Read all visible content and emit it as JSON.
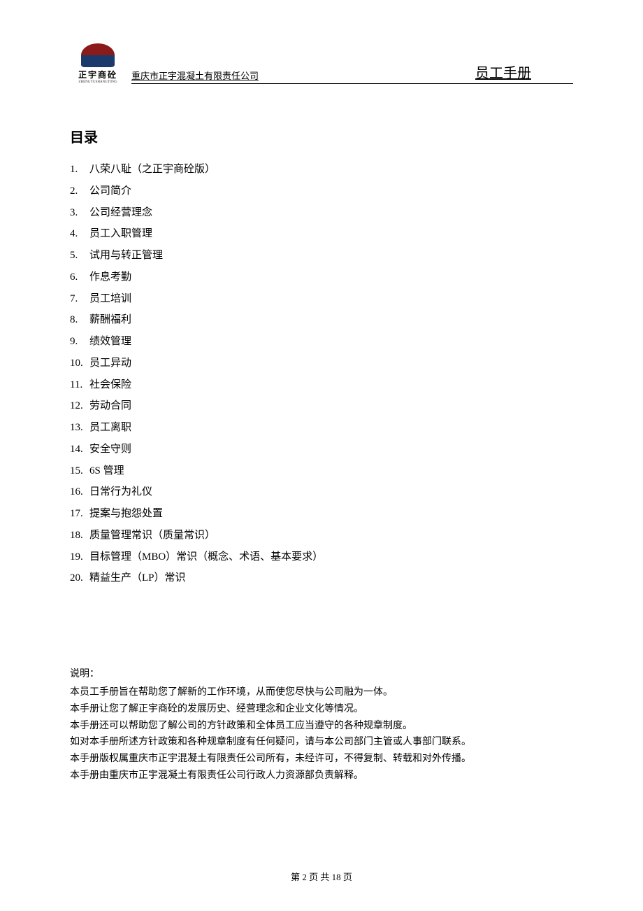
{
  "header": {
    "logo_text": "正宇商砼",
    "logo_sub": "ZHENGYUSHANGTONG",
    "company": "重庆市正宇混凝土有限责任公司",
    "doc_title": "员工手册"
  },
  "toc": {
    "heading": "目录",
    "items": [
      {
        "num": "1.",
        "label": "八荣八耻（之正宇商砼版）"
      },
      {
        "num": "2.",
        "label": "公司简介"
      },
      {
        "num": "3.",
        "label": "公司经营理念"
      },
      {
        "num": "4.",
        "label": "员工入职管理"
      },
      {
        "num": "5.",
        "label": "试用与转正管理"
      },
      {
        "num": "6.",
        "label": "作息考勤"
      },
      {
        "num": "7.",
        "label": "员工培训"
      },
      {
        "num": "8.",
        "label": "薪酬福利"
      },
      {
        "num": "9.",
        "label": "绩效管理"
      },
      {
        "num": "10.",
        "label": "员工异动"
      },
      {
        "num": "11.",
        "label": "社会保险"
      },
      {
        "num": "12.",
        "label": "劳动合同"
      },
      {
        "num": "13.",
        "label": "员工离职"
      },
      {
        "num": "14.",
        "label": "安全守则"
      },
      {
        "num": "15.",
        "label": "6S 管理"
      },
      {
        "num": "16.",
        "label": "日常行为礼仪"
      },
      {
        "num": "17.",
        "label": "提案与抱怨处置"
      },
      {
        "num": "18.",
        "label": "质量管理常识（质量常识）"
      },
      {
        "num": "19.",
        "label": "目标管理（MBO）常识（概念、术语、基本要求）"
      },
      {
        "num": "20.",
        "label": "精益生产（LP）常识"
      }
    ]
  },
  "explain": {
    "heading": "说明：",
    "lines": [
      "本员工手册旨在帮助您了解新的工作环境，从而使您尽快与公司融为一体。",
      "本手册让您了解正宇商砼的发展历史、经营理念和企业文化等情况。",
      "本手册还可以帮助您了解公司的方针政策和全体员工应当遵守的各种规章制度。",
      "如对本手册所述方针政策和各种规章制度有任何疑问，请与本公司部门主管或人事部门联系。",
      "本手册版权属重庆市正宇混凝土有限责任公司所有，未经许可，不得复制、转载和对外传播。",
      "本手册由重庆市正宇混凝土有限责任公司行政人力资源部负责解释。"
    ]
  },
  "footer": {
    "text": "第 2 页 共 18 页"
  }
}
